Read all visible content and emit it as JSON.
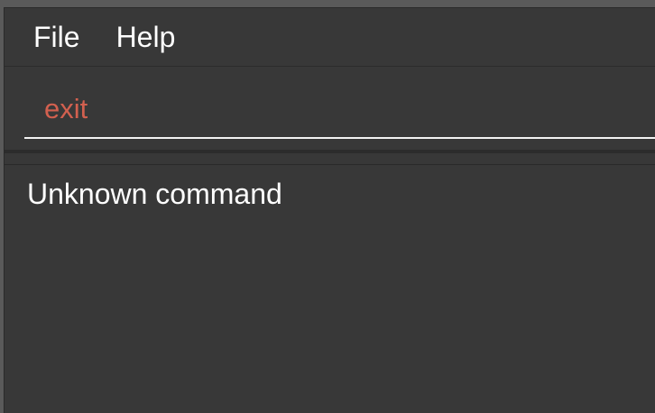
{
  "menu": {
    "file_label": "File",
    "help_label": "Help"
  },
  "command": {
    "value": "exit",
    "text_color": "#d2604f"
  },
  "result": {
    "text": "Unknown command"
  },
  "colors": {
    "background": "#383838",
    "text": "#ffffff",
    "error_text": "#d2604f"
  }
}
